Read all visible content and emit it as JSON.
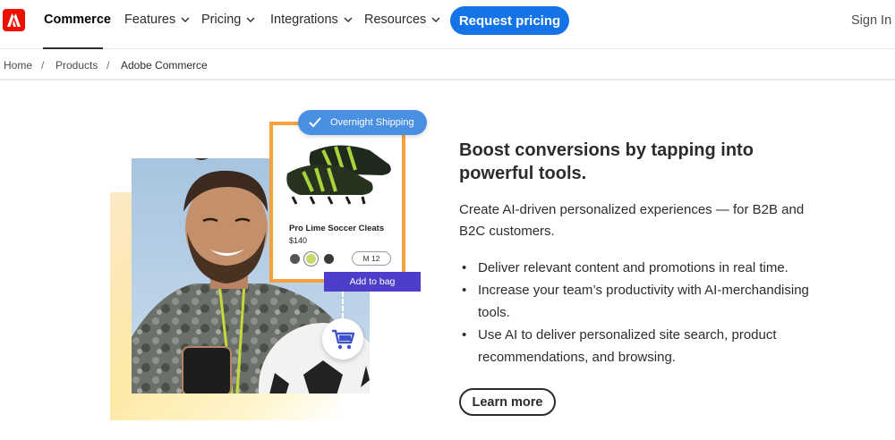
{
  "nav": {
    "brand": "Commerce",
    "items": [
      {
        "label": "Features"
      },
      {
        "label": "Pricing"
      },
      {
        "label": "Integrations"
      },
      {
        "label": "Resources"
      }
    ],
    "cta": "Request pricing",
    "signin": "Sign In"
  },
  "breadcrumb": {
    "items": [
      "Home",
      "Products",
      "Adobe Commerce"
    ],
    "separator": "/"
  },
  "promo": {
    "shipping_badge": "Overnight Shipping",
    "product_name": "Pro Lime Soccer Cleats",
    "product_price": "$140",
    "size": "M 12",
    "add_to_bag": "Add to bag",
    "swatch_colors": [
      "#555555",
      "#c6db6a",
      "#3a3a3a"
    ],
    "card_accent": "#f6a23c"
  },
  "hero": {
    "headline": "Boost conversions by tapping into powerful tools.",
    "description": "Create AI-driven personalized experiences — for B2B and B2C customers.",
    "bullets": [
      "Deliver relevant content and promotions in real time.",
      "Increase your team’s productivity with AI-merchandising tools.",
      "Use AI to deliver personalized site search, product recommendations, and browsing."
    ],
    "cta": "Learn more"
  },
  "colors": {
    "brand_red": "#eb1000",
    "primary_blue": "#1473e6",
    "addbag_purple": "#4d3ec9",
    "badge_blue": "#4a90e2"
  }
}
